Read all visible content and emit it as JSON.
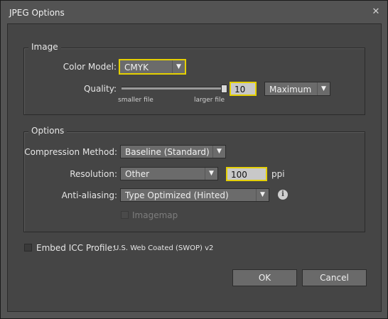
{
  "window": {
    "title": "JPEG Options",
    "close_glyph": "✕"
  },
  "image_group": {
    "legend": "Image",
    "color_model_label": "Color Model:",
    "color_model_value": "CMYK",
    "quality_label": "Quality:",
    "quality_value": "10",
    "quality_preset": "Maximum",
    "slider_left_label": "smaller file",
    "slider_right_label": "larger file",
    "slider_level": 1.0
  },
  "options_group": {
    "legend": "Options",
    "compression_label": "Compression Method:",
    "compression_value": "Baseline (Standard)",
    "resolution_label": "Resolution:",
    "resolution_value": "Other",
    "resolution_ppi": "100",
    "ppi_unit": "ppi",
    "antialias_label": "Anti-aliasing:",
    "antialias_value": "Type Optimized (Hinted)",
    "imagemap_label": "Imagemap",
    "imagemap_checked": false
  },
  "icc": {
    "label": "Embed ICC Profile:",
    "profile": "U.S. Web Coated (SWOP) v2",
    "checked": false
  },
  "buttons": {
    "ok": "OK",
    "cancel": "Cancel"
  },
  "icons": {
    "dropdown": "chevron-down-icon",
    "info": "info-icon",
    "close": "close-icon"
  },
  "colors": {
    "focus_highlight": "#e5d000",
    "background": "#454545"
  }
}
